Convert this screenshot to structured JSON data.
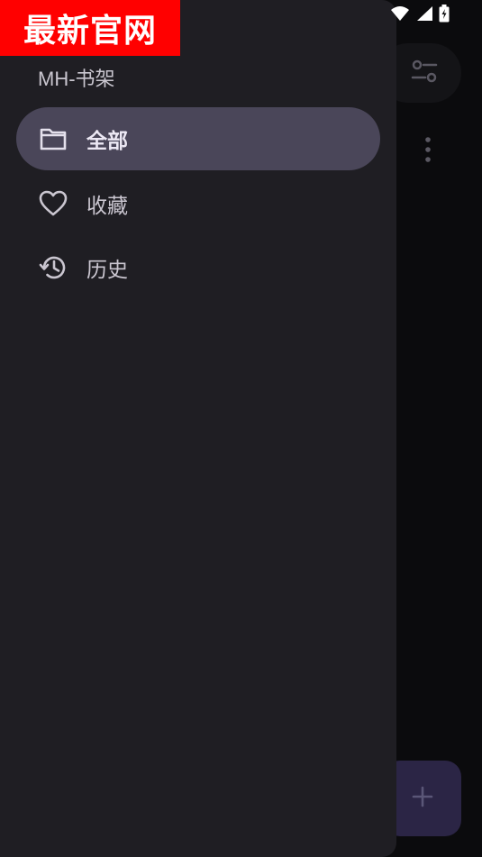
{
  "watermark": {
    "text": "最新官网"
  },
  "drawer": {
    "title": "MH-书架",
    "items": [
      {
        "label": "全部",
        "icon": "folder-icon",
        "active": true
      },
      {
        "label": "收藏",
        "icon": "heart-icon",
        "active": false
      },
      {
        "label": "历史",
        "icon": "history-icon",
        "active": false
      }
    ]
  },
  "background": {
    "icons": [
      "filter-icon",
      "more-vert-icon",
      "add-icon"
    ]
  },
  "status_bar": {
    "icons": [
      "wifi-icon",
      "signal-icon",
      "battery-charging-icon"
    ]
  },
  "colors": {
    "drawer_bg": "#1f1e23",
    "active_item_bg": "#4a4659",
    "watermark_bg": "#ff0000",
    "fab_bg": "#2b2545"
  }
}
